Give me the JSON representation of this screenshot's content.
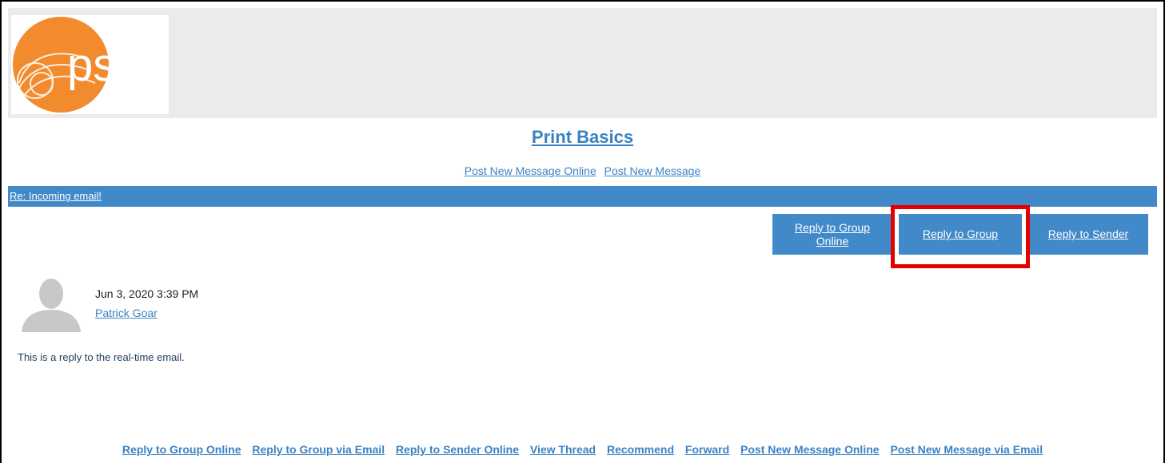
{
  "logo": {
    "text": "psda"
  },
  "group": {
    "title": "Print Basics"
  },
  "top_links": {
    "post_online": "Post New Message Online",
    "post_message": "Post New Message"
  },
  "thread": {
    "subject": "Re: Incoming email!"
  },
  "buttons": {
    "reply_group_online": "Reply to Group Online",
    "reply_group": "Reply to Group",
    "reply_sender": "Reply to Sender"
  },
  "post": {
    "date": "Jun 3, 2020 3:39 PM",
    "author": "Patrick Goar",
    "body": "This is a reply to the real-time email."
  },
  "bottom_links": {
    "reply_group_online": "Reply to Group Online",
    "reply_group_email": "Reply to Group via Email",
    "reply_sender_online": "Reply to Sender Online",
    "view_thread": "View Thread",
    "recommend": "Recommend",
    "forward": "Forward",
    "post_online": "Post New Message Online",
    "post_email": "Post New Message via Email"
  },
  "colors": {
    "accent_blue": "#4189c9",
    "link_blue": "#3b82c4",
    "logo_orange": "#f28a2e",
    "highlight_red": "#e50000"
  }
}
